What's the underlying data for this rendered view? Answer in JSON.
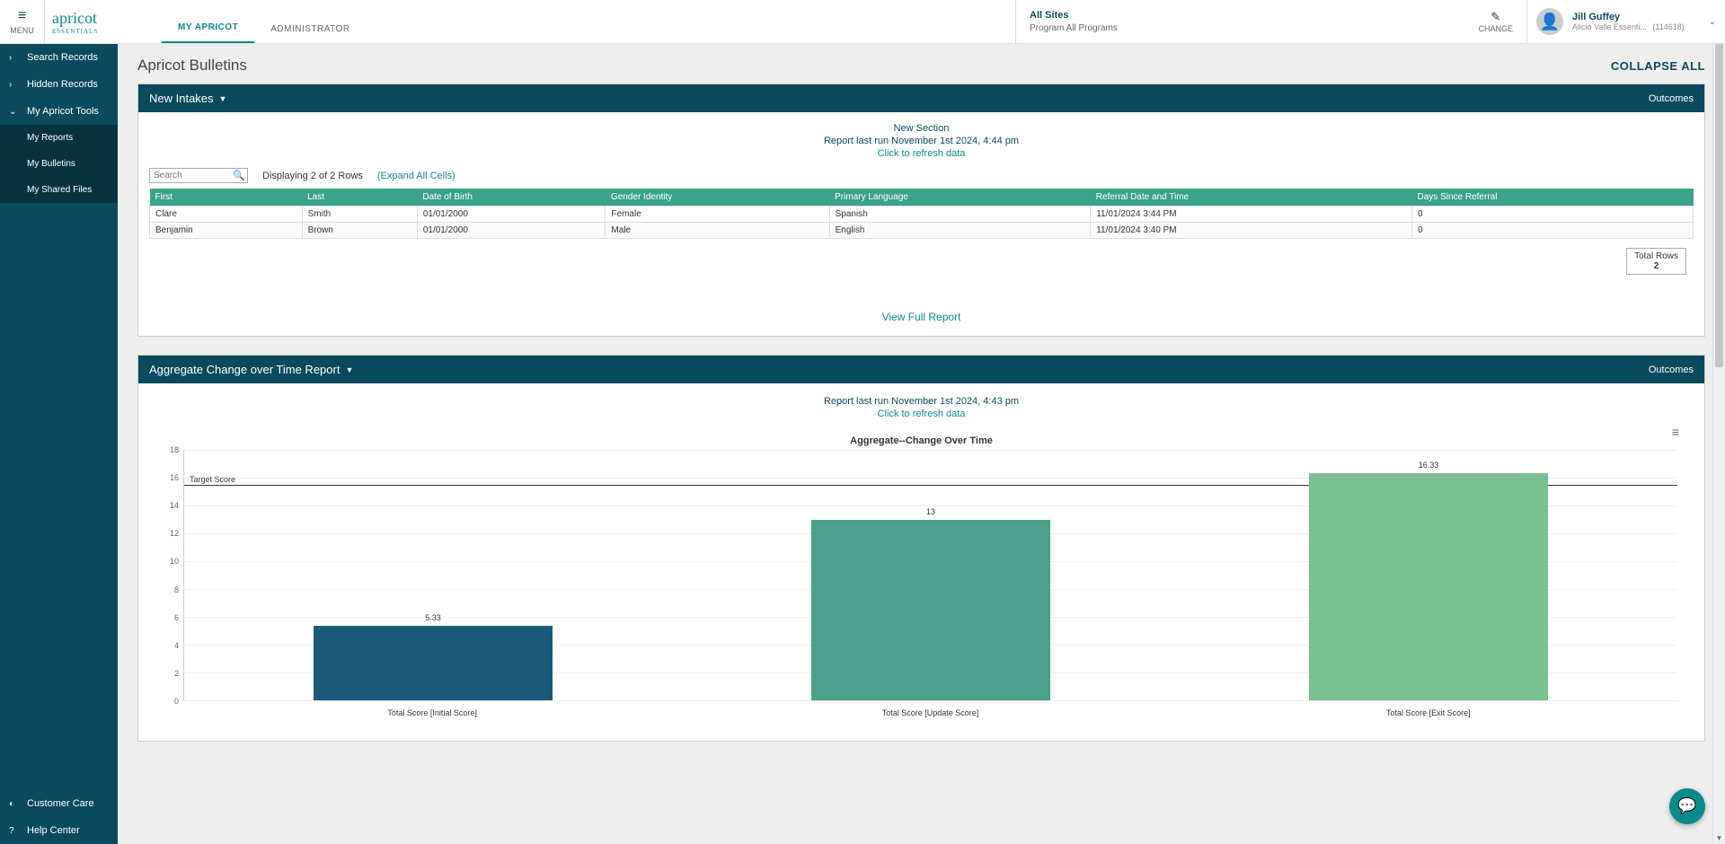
{
  "header": {
    "menu_label": "MENU",
    "logo_main": "apricot",
    "logo_sub": "ESSENTIALS",
    "tabs": [
      "MY APRICOT",
      "ADMINISTRATOR"
    ],
    "active_tab": 0,
    "sites_label": "All Sites",
    "program_label": "Program All Programs",
    "change_label": "CHANGE",
    "user_name": "Jill Guffey",
    "org_name": "Alicio Valle Essenti...",
    "org_id": "(114618)"
  },
  "sidebar": {
    "items": [
      {
        "label": "Search Records",
        "icon": "›"
      },
      {
        "label": "Hidden Records",
        "icon": "›"
      },
      {
        "label": "My Apricot Tools",
        "icon": "⌄",
        "expanded": true
      },
      {
        "label": "My Reports",
        "sub": true
      },
      {
        "label": "My Bulletins",
        "sub": true
      },
      {
        "label": "My Shared Files",
        "sub": true
      }
    ],
    "footer": [
      {
        "label": "Customer Care",
        "icon": "◐"
      },
      {
        "label": "Help Center",
        "icon": "?"
      }
    ]
  },
  "page": {
    "title": "Apricot Bulletins",
    "collapse_all": "COLLAPSE ALL"
  },
  "bulletin1": {
    "title": "New Intakes",
    "right_label": "Outcomes",
    "section_title": "New Section",
    "last_run": "Report last run November 1st 2024, 4:44 pm",
    "refresh": "Click to refresh data",
    "search_placeholder": "Search",
    "rows_info": "Displaying 2 of 2 Rows",
    "expand_link": "(Expand All Cells)",
    "columns": [
      "First",
      "Last",
      "Date of Birth",
      "Gender Identity",
      "Primary Language",
      "Referral Date and Time",
      "Days Since Referral"
    ],
    "rows": [
      [
        "Clare",
        "Smith",
        "01/01/2000",
        "Female",
        "Spanish",
        "11/01/2024 3:44 PM",
        "0"
      ],
      [
        "Benjamin",
        "Brown",
        "01/01/2000",
        "Male",
        "English",
        "11/01/2024 3:40 PM",
        "0"
      ]
    ],
    "total_label": "Total Rows",
    "total_value": "2",
    "view_full": "View Full Report"
  },
  "bulletin2": {
    "title": "Aggregate Change over Time Report",
    "right_label": "Outcomes",
    "last_run": "Report last run November 1st 2024, 4:43 pm",
    "refresh": "Click to refresh data"
  },
  "chart_data": {
    "type": "bar",
    "title": "Aggregate--Change Over Time",
    "categories": [
      "Total Score [Initial Score]",
      "Total Score [Update Score]",
      "Total Score [Exit Score]"
    ],
    "values": [
      5.33,
      13,
      16.33
    ],
    "colors": [
      "#1a5a78",
      "#4aa088",
      "#7ac090"
    ],
    "ylim": [
      0,
      18
    ],
    "y_ticks": [
      0,
      2,
      4,
      6,
      8,
      10,
      12,
      14,
      16,
      18
    ],
    "target_line": {
      "value": 15.5,
      "label": "Target Score"
    }
  }
}
